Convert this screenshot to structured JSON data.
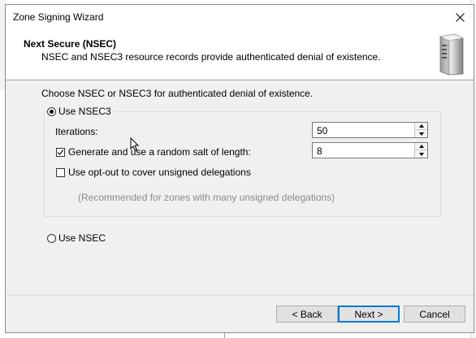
{
  "window": {
    "title": "Zone Signing Wizard",
    "close_icon": "close-icon"
  },
  "header": {
    "title": "Next Secure (NSEC)",
    "description": "NSEC and NSEC3 resource records provide authenticated denial of existence.",
    "icon": "server-icon"
  },
  "main": {
    "prompt": "Choose NSEC or NSEC3 for authenticated denial of existence.",
    "nsec3": {
      "label": "Use NSEC3",
      "selected": true,
      "iterations_label": "Iterations:",
      "iterations_value": "50",
      "salt_label": "Generate and use a random salt of length:",
      "salt_checked": true,
      "salt_value": "8",
      "optout_label": "Use opt-out to cover unsigned delegations",
      "optout_checked": false,
      "optout_hint": "(Recommended for zones with many unsigned delegations)"
    },
    "nsec": {
      "label": "Use NSEC",
      "selected": false
    }
  },
  "footer": {
    "back_label": "< Back",
    "next_label": "Next >",
    "cancel_label": "Cancel"
  },
  "colors": {
    "accent": "#0078d7",
    "dialog_bg": "#f0f0f0",
    "hint_text": "#8a8a8a"
  }
}
